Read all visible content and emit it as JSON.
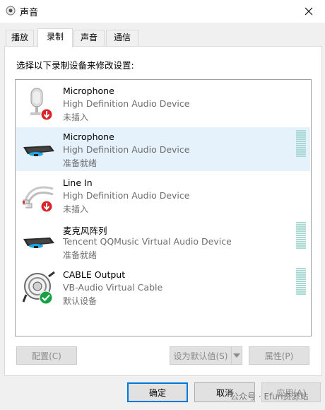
{
  "window": {
    "title": "声音"
  },
  "tabs": [
    {
      "label": "播放"
    },
    {
      "label": "录制"
    },
    {
      "label": "声音"
    },
    {
      "label": "通信"
    }
  ],
  "panel": {
    "caption": "选择以下录制设备来修改设置:"
  },
  "devices": [
    {
      "name": "Microphone",
      "description": "High Definition Audio Device",
      "status": "未插入",
      "icon": "studio-microphone-icon",
      "badge": "unplugged-badge-icon"
    },
    {
      "name": "Microphone",
      "description": "High Definition Audio Device",
      "status": "准备就绪",
      "icon": "bar-microphone-icon",
      "badge": "",
      "selected": true
    },
    {
      "name": "Line In",
      "description": "High Definition Audio Device",
      "status": "未插入",
      "icon": "rca-cable-icon",
      "badge": "unplugged-badge-icon"
    },
    {
      "name": "麦克风阵列",
      "description": "Tencent QQMusic Virtual Audio Device",
      "status": "准备就绪",
      "icon": "bar-microphone-icon",
      "badge": ""
    },
    {
      "name": "CABLE Output",
      "description": "VB-Audio Virtual Cable",
      "status": "默认设备",
      "icon": "cable-reel-icon",
      "badge": "default-check-badge-icon"
    }
  ],
  "buttons": {
    "configure": "配置(C)",
    "set_default": "设为默认值(S)",
    "properties": "属性(P)"
  },
  "footer": {
    "ok": "确定",
    "cancel": "取消",
    "apply": "应用(A)"
  },
  "watermark": "公众号 · Efun资源站",
  "colors": {
    "accent": "#0078d7",
    "selected_row": "#e5f1fb",
    "level_meter": "#a8d8d4"
  }
}
